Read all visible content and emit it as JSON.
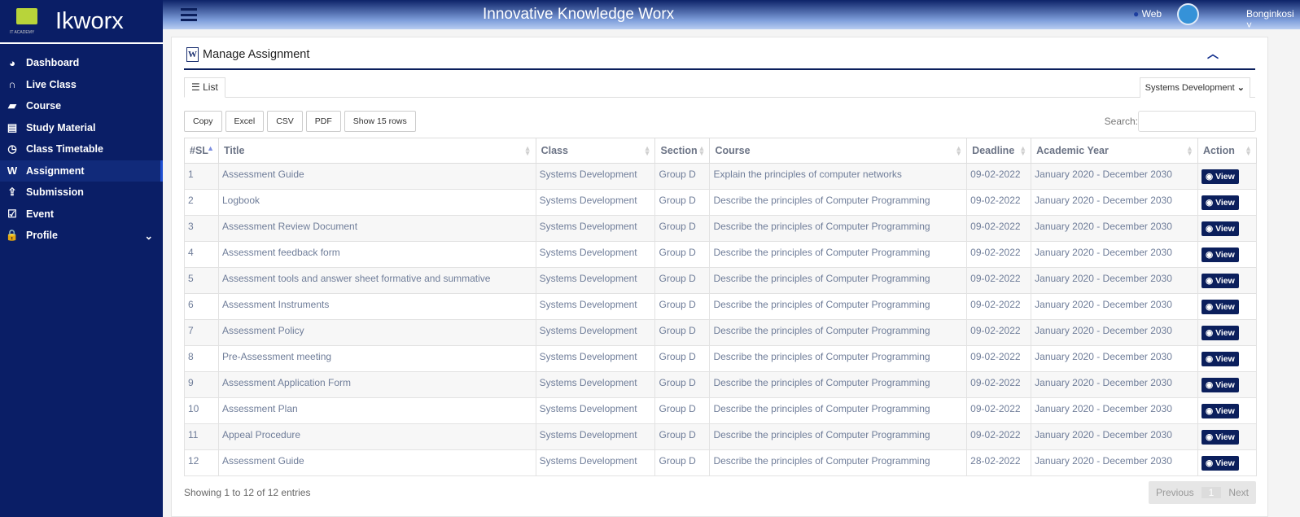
{
  "brand": {
    "name": "Ikworx",
    "logo_text": "IT ACADEMY"
  },
  "sidebar": [
    {
      "label": "Dashboard",
      "icon": "dashboard-icon",
      "glyph": "◕"
    },
    {
      "label": "Live Class",
      "icon": "headphones-icon",
      "glyph": "∩"
    },
    {
      "label": "Course",
      "icon": "folder-open-icon",
      "glyph": "▰"
    },
    {
      "label": "Study Material",
      "icon": "file-text-icon",
      "glyph": "▤"
    },
    {
      "label": "Class Timetable",
      "icon": "clock-icon",
      "glyph": "◷"
    },
    {
      "label": "Assignment",
      "icon": "word-file-icon",
      "glyph": "W"
    },
    {
      "label": "Submission",
      "icon": "upload-icon",
      "glyph": "⇪"
    },
    {
      "label": "Event",
      "icon": "calendar-check-icon",
      "glyph": "☑"
    },
    {
      "label": "Profile",
      "icon": "lock-icon",
      "glyph": "🔒"
    }
  ],
  "topbar": {
    "title": "Innovative Knowledge Worx",
    "web": "Web",
    "user": "Bonginkosi"
  },
  "panel": {
    "title": "Manage Assignment",
    "tab": "List",
    "class_select": "Systems Development"
  },
  "toolbar": {
    "copy": "Copy",
    "excel": "Excel",
    "csv": "CSV",
    "pdf": "PDF",
    "show": "Show 15 rows",
    "search_label": "Search:"
  },
  "columns": [
    "#SL",
    "Title",
    "Class",
    "Section",
    "Course",
    "Deadline",
    "Academic Year",
    "Action"
  ],
  "rows": [
    [
      "1",
      "Assessment Guide",
      "Systems Development",
      "Group D",
      "Explain the principles of computer networks",
      "09-02-2022",
      "January 2020 - December 2030"
    ],
    [
      "2",
      "Logbook",
      "Systems Development",
      "Group D",
      "Describe the principles of Computer Programming",
      "09-02-2022",
      "January 2020 - December 2030"
    ],
    [
      "3",
      "Assessment Review Document",
      "Systems Development",
      "Group D",
      "Describe the principles of Computer Programming",
      "09-02-2022",
      "January 2020 - December 2030"
    ],
    [
      "4",
      "Assessment feedback form",
      "Systems Development",
      "Group D",
      "Describe the principles of Computer Programming",
      "09-02-2022",
      "January 2020 - December 2030"
    ],
    [
      "5",
      "Assessment tools and answer sheet formative and summative",
      "Systems Development",
      "Group D",
      "Describe the principles of Computer Programming",
      "09-02-2022",
      "January 2020 - December 2030"
    ],
    [
      "6",
      "Assessment Instruments",
      "Systems Development",
      "Group D",
      "Describe the principles of Computer Programming",
      "09-02-2022",
      "January 2020 - December 2030"
    ],
    [
      "7",
      "Assessment Policy",
      "Systems Development",
      "Group D",
      "Describe the principles of Computer Programming",
      "09-02-2022",
      "January 2020 - December 2030"
    ],
    [
      "8",
      "Pre-Assessment meeting",
      "Systems Development",
      "Group D",
      "Describe the principles of Computer Programming",
      "09-02-2022",
      "January 2020 - December 2030"
    ],
    [
      "9",
      "Assessment Application Form",
      "Systems Development",
      "Group D",
      "Describe the principles of Computer Programming",
      "09-02-2022",
      "January 2020 - December 2030"
    ],
    [
      "10",
      "Assessment Plan",
      "Systems Development",
      "Group D",
      "Describe the principles of Computer Programming",
      "09-02-2022",
      "January 2020 - December 2030"
    ],
    [
      "11",
      "Appeal Procedure",
      "Systems Development",
      "Group D",
      "Describe the principles of Computer Programming",
      "09-02-2022",
      "January 2020 - December 2030"
    ],
    [
      "12",
      "Assessment Guide",
      "Systems Development",
      "Group D",
      "Describe the principles of Computer Programming",
      "28-02-2022",
      "January 2020 - December 2030"
    ]
  ],
  "view_label": "View",
  "footer": {
    "info": "Showing 1 to 12 of 12 entries",
    "prev": "Previous",
    "page": "1",
    "next": "Next"
  }
}
